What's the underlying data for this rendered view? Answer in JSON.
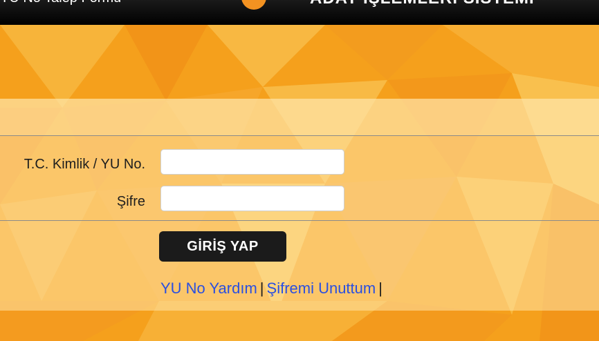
{
  "topbar": {
    "left_link": "YU No Talep Formu",
    "system_title": "ADAY İŞLEMLERİ SİSTEMİ"
  },
  "form": {
    "user_label": "T.C. Kimlik / YU No.",
    "user_value": "",
    "password_label": "Şifre",
    "password_value": "",
    "login_button": "GİRİŞ YAP"
  },
  "links": {
    "help": "YU No Yardım",
    "forgot": "Şifremi Unuttum",
    "separator": "|"
  },
  "colors": {
    "accent_orange": "#f6a21d",
    "link_blue": "#2a4fe0",
    "button_dark": "#1b1b1b"
  }
}
